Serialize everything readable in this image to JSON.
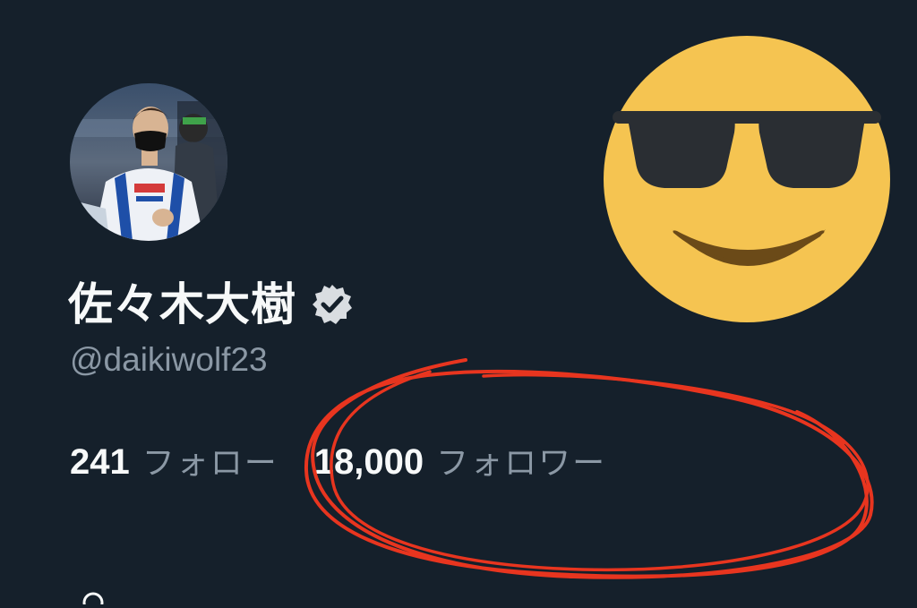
{
  "profile": {
    "display_name": "佐々木大樹",
    "handle": "@daikiwolf23",
    "verified": true,
    "avatar_alt": "profile photo"
  },
  "stats": {
    "following_count": "241",
    "following_label": "フォロー",
    "followers_count": "18,000",
    "followers_label": "フォロワー"
  },
  "colors": {
    "background": "#15202b",
    "primary_text": "#f7f9f9",
    "secondary_text": "#8b98a5",
    "annotation": "#e8351f",
    "emoji_face": "#f5c451"
  },
  "decorations": {
    "emoji": "smiling-face-with-sunglasses",
    "annotation": "red-hand-drawn-circle"
  }
}
